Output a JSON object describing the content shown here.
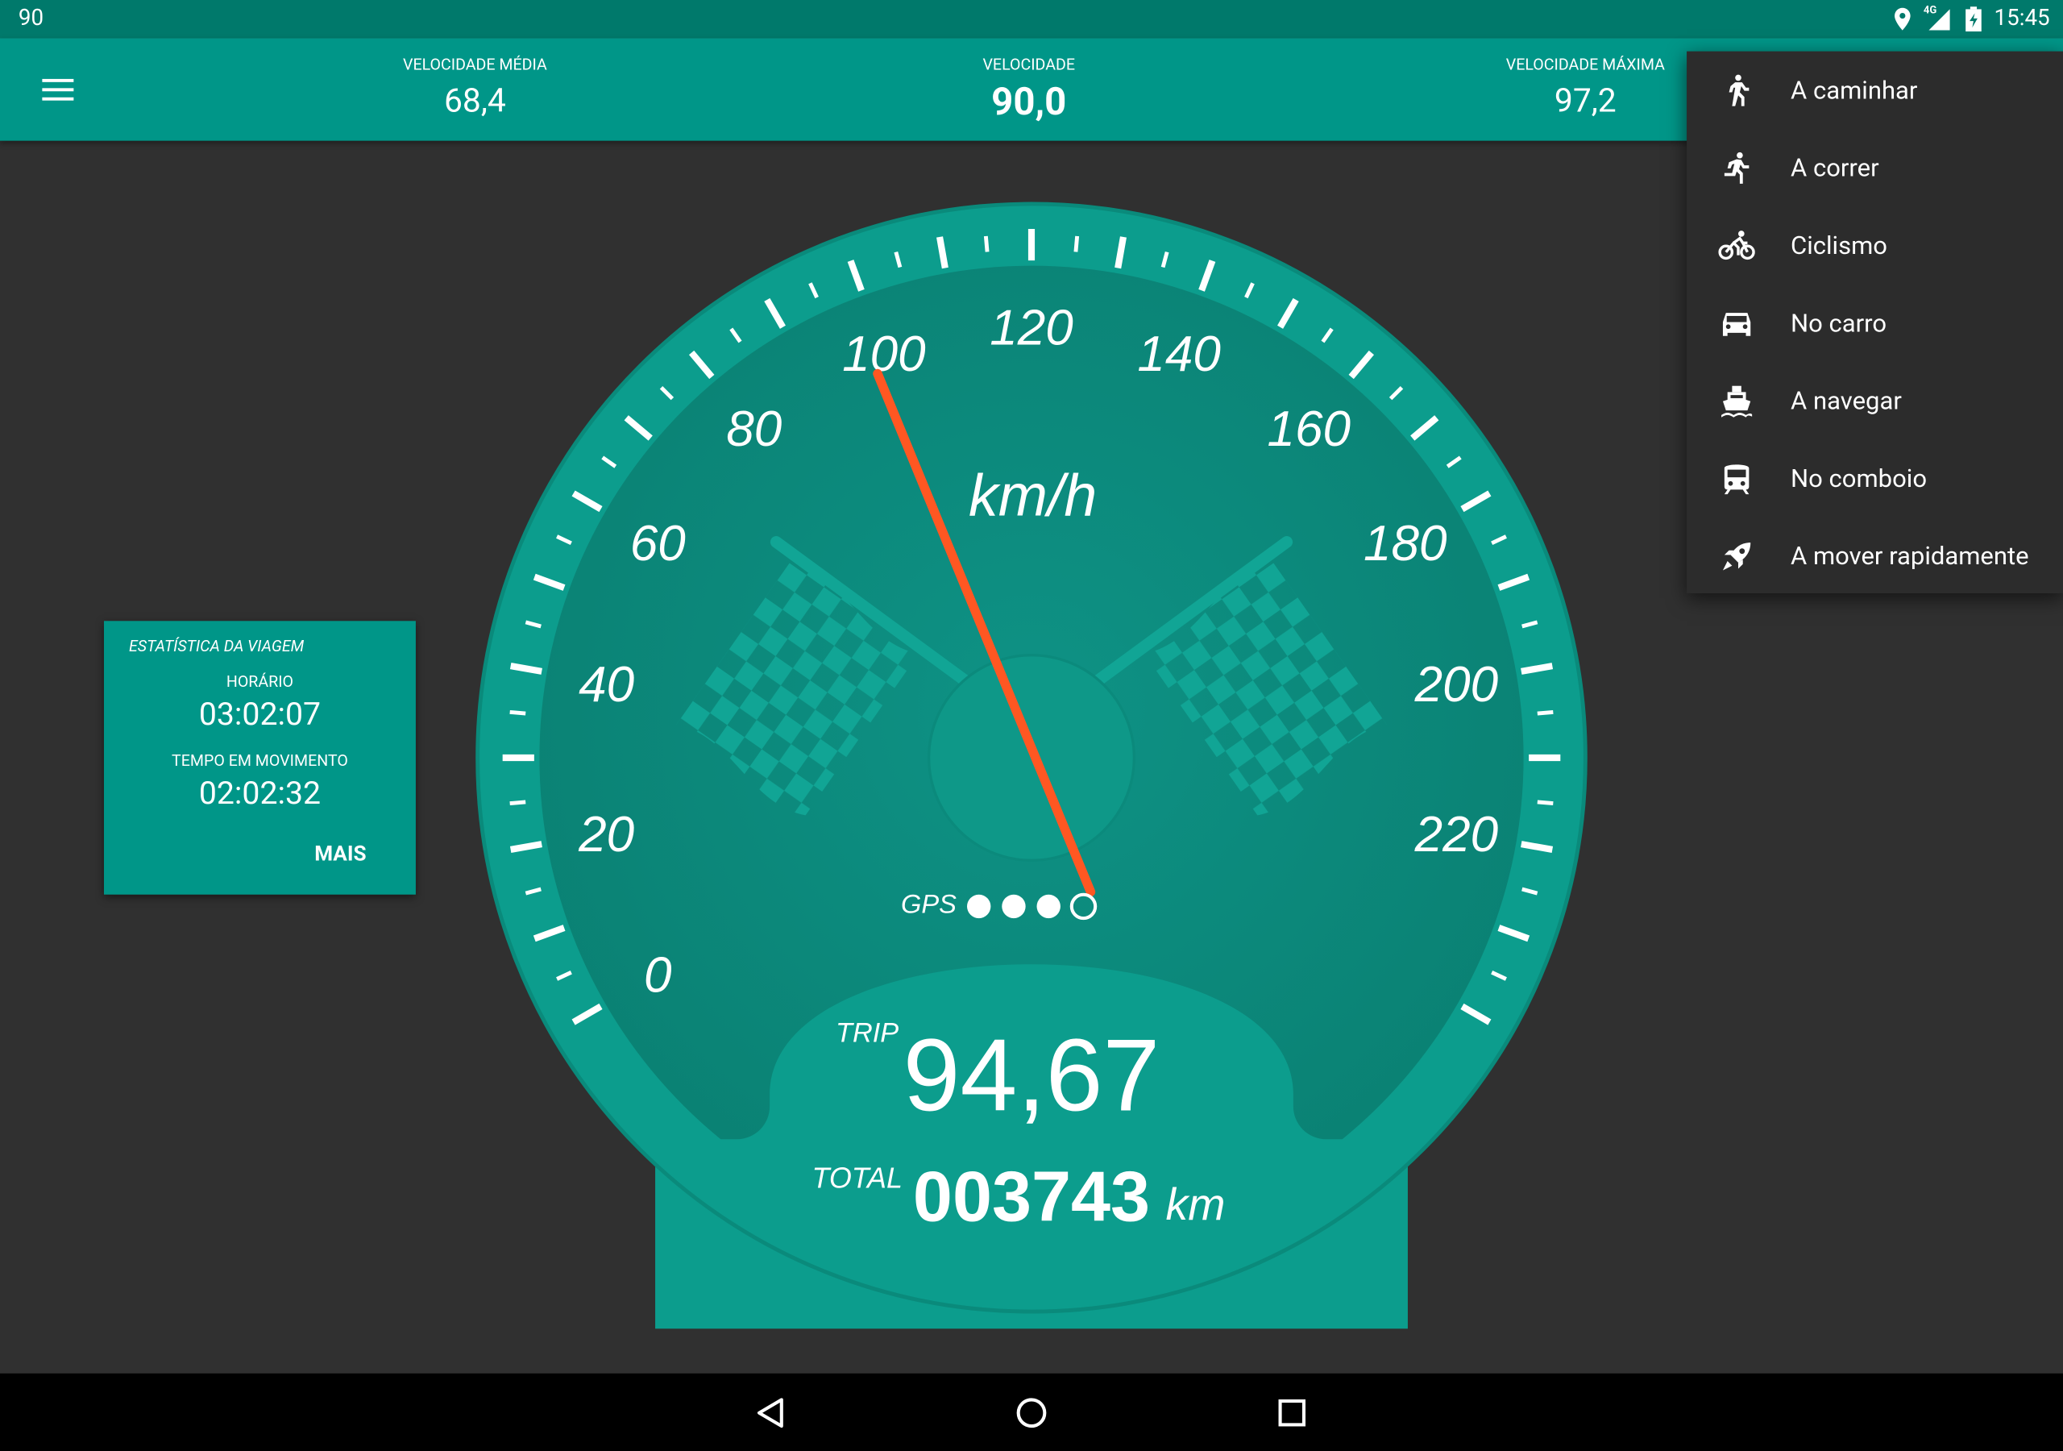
{
  "status_bar": {
    "notification_text": "90",
    "network_label": "4G",
    "time": "15:45"
  },
  "app_bar": {
    "avg_speed_label": "VELOCIDADE MÉDIA",
    "avg_speed_value": "68,4",
    "speed_label": "VELOCIDADE",
    "speed_value": "90,0",
    "max_speed_label": "VELOCIDADE MÁXIMA",
    "max_speed_value": "97,2"
  },
  "trip_card": {
    "title": "ESTATÍSTICA DA VIAGEM",
    "time_label": "HORÁRIO",
    "time_value": "03:02:07",
    "moving_label": "TEMPO EM MOVIMENTO",
    "moving_value": "02:02:32",
    "more_label": "MAIS"
  },
  "speedometer": {
    "unit": "km/h",
    "scale_labels": [
      "0",
      "20",
      "40",
      "60",
      "80",
      "100",
      "120",
      "140",
      "160",
      "180",
      "200",
      "220"
    ],
    "scale_max": 240,
    "needle_value": 90,
    "gps_label": "GPS",
    "gps_signal_filled": 3,
    "gps_signal_total": 4,
    "trip_label": "TRIP",
    "trip_value": "94,67",
    "total_label": "TOTAL",
    "total_value": "003743",
    "total_unit": "km",
    "colors": {
      "dial": "#0c8c7e",
      "rim": "#0a9a8b",
      "needle": "#ff5722"
    }
  },
  "menu": {
    "items": [
      {
        "label": "A caminhar",
        "icon": "walk-icon"
      },
      {
        "label": "A correr",
        "icon": "run-icon"
      },
      {
        "label": "Ciclismo",
        "icon": "bike-icon"
      },
      {
        "label": "No carro",
        "icon": "car-icon"
      },
      {
        "label": "A navegar",
        "icon": "boat-icon"
      },
      {
        "label": "No comboio",
        "icon": "train-icon"
      },
      {
        "label": "A mover rapidamente",
        "icon": "rocket-icon"
      }
    ]
  },
  "nav_bar": {
    "buttons": [
      "back",
      "home",
      "recents"
    ]
  }
}
